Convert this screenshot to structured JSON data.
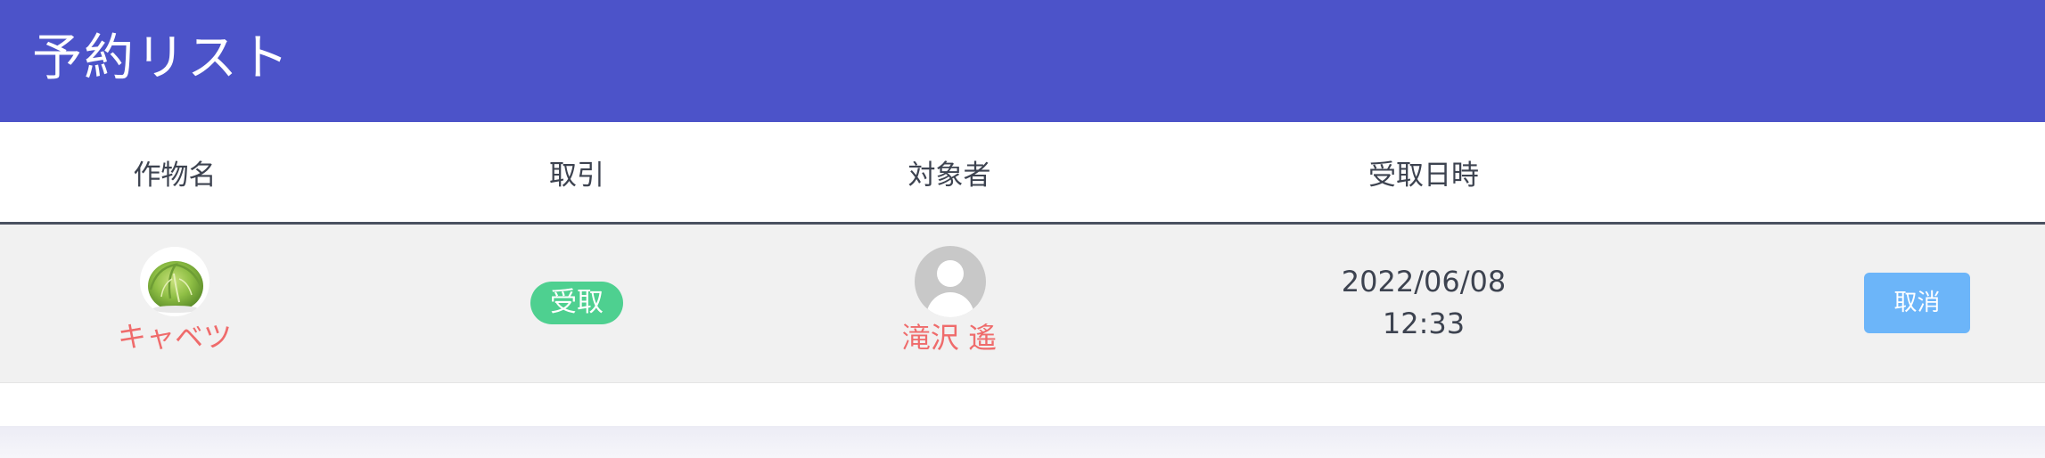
{
  "header": {
    "title": "予約リスト"
  },
  "table": {
    "columns": [
      "作物名",
      "取引",
      "対象者",
      "受取日時"
    ],
    "rows": [
      {
        "crop_name": "キャベツ",
        "crop_icon": "cabbage-image",
        "transaction": "受取",
        "person": "滝沢 遙",
        "person_icon": "user-avatar-icon",
        "date": "2022/06/08",
        "time": "12:33",
        "action_label": "取消"
      }
    ]
  },
  "colors": {
    "header_bg": "#4c53c9",
    "badge_bg": "#4ed090",
    "name_text": "#ef6b6b",
    "cancel_button_bg": "#6cb5f9"
  }
}
